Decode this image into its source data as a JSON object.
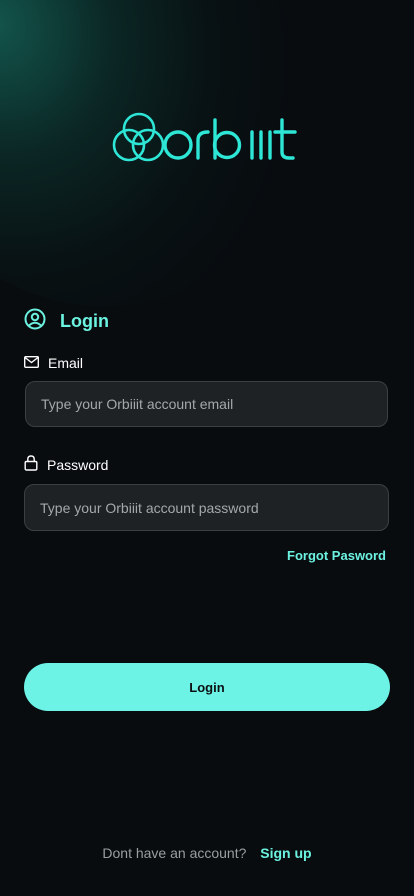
{
  "brand": {
    "logo_text": "orbiiit",
    "accent_color": "#6cf2e0",
    "background_color": "#080c0f"
  },
  "login_section": {
    "title": "Login",
    "icon": "user-circle-icon"
  },
  "email": {
    "label": "Email",
    "icon": "envelope-icon",
    "placeholder": "Type your Orbiiit account email",
    "value": ""
  },
  "password": {
    "label": "Password",
    "icon": "lock-icon",
    "placeholder": "Type your Orbiiit account password",
    "value": ""
  },
  "forgot_password": {
    "label": "Forgot Pasword"
  },
  "login_button": {
    "label": "Login"
  },
  "signup": {
    "prompt": "Dont have an account?",
    "link_label": "Sign up"
  }
}
